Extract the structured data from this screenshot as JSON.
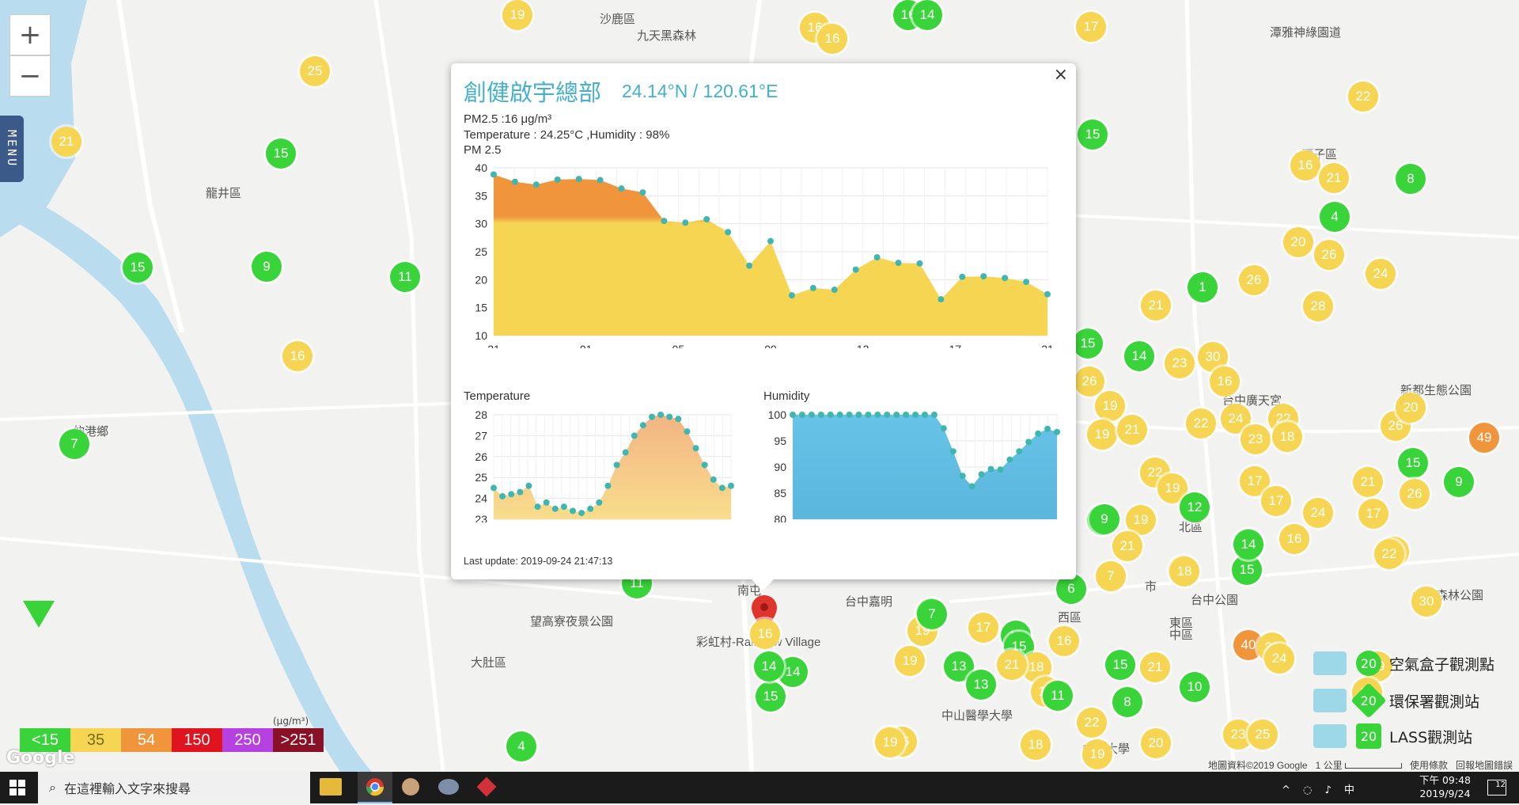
{
  "map": {
    "zoom_in": "+",
    "zoom_out": "−",
    "menu_label": "MENU",
    "places": [
      {
        "name": "沙鹿區"
      },
      {
        "name": "龍井區"
      },
      {
        "name": "伸港鄉"
      },
      {
        "name": "大肚區"
      },
      {
        "name": "潭子區"
      },
      {
        "name": "北區"
      },
      {
        "name": "西區"
      },
      {
        "name": "東區"
      },
      {
        "name": "中區"
      },
      {
        "name": "南屯"
      },
      {
        "name": "望高寮夜景公園"
      },
      {
        "name": "彩虹村-Rainbow Village"
      },
      {
        "name": "九天黑森林"
      },
      {
        "name": "潭雅神綠園道"
      },
      {
        "name": "中山醫學大學"
      },
      {
        "name": "台中嘉明"
      },
      {
        "name": "中興大學"
      },
      {
        "name": "台中公園"
      },
      {
        "name": "市"
      },
      {
        "name": "大坑森林公園"
      },
      {
        "name": "新都生態公園"
      },
      {
        "name": "台中廣天宮"
      }
    ],
    "markers": [
      {
        "v": "19",
        "c": "#f6d553"
      },
      {
        "v": "16",
        "c": "#f6d553"
      },
      {
        "v": "16",
        "c": "#f6d553"
      },
      {
        "v": "16",
        "c": "#39d33a"
      },
      {
        "v": "14",
        "c": "#39d33a"
      },
      {
        "v": "17",
        "c": "#f6d553"
      },
      {
        "v": "25",
        "c": "#f6d553"
      },
      {
        "v": "21",
        "c": "#f6d553"
      },
      {
        "v": "15",
        "c": "#39d33a"
      },
      {
        "v": "15",
        "c": "#39d33a"
      },
      {
        "v": "9",
        "c": "#39d33a"
      },
      {
        "v": "11",
        "c": "#39d33a"
      },
      {
        "v": "16",
        "c": "#f6d553"
      },
      {
        "v": "7",
        "c": "#39d33a"
      },
      {
        "v": "15",
        "c": "#39d33a"
      },
      {
        "v": "22",
        "c": "#f6d553"
      },
      {
        "v": "16",
        "c": "#f6d553"
      },
      {
        "v": "21",
        "c": "#f6d553"
      },
      {
        "v": "8",
        "c": "#39d33a"
      },
      {
        "v": "4",
        "c": "#39d33a"
      },
      {
        "v": "20",
        "c": "#f6d553"
      },
      {
        "v": "26",
        "c": "#f6d553"
      },
      {
        "v": "24",
        "c": "#f6d553"
      },
      {
        "v": "1",
        "c": "#39d33a"
      },
      {
        "v": "26",
        "c": "#f6d553"
      },
      {
        "v": "21",
        "c": "#f6d553"
      },
      {
        "v": "28",
        "c": "#f6d553"
      },
      {
        "v": "15",
        "c": "#39d33a"
      },
      {
        "v": "14",
        "c": "#39d33a"
      },
      {
        "v": "23",
        "c": "#f6d553"
      },
      {
        "v": "30",
        "c": "#f6d553"
      },
      {
        "v": "16",
        "c": "#f6d553"
      },
      {
        "v": "26",
        "c": "#f6d553"
      },
      {
        "v": "19",
        "c": "#f6d553"
      },
      {
        "v": "22",
        "c": "#f6d553"
      },
      {
        "v": "24",
        "c": "#f6d553"
      },
      {
        "v": "22",
        "c": "#f6d553"
      },
      {
        "v": "23",
        "c": "#f6d553"
      },
      {
        "v": "18",
        "c": "#f6d553"
      },
      {
        "v": "19",
        "c": "#f6d553"
      },
      {
        "v": "21",
        "c": "#f6d553"
      },
      {
        "v": "26",
        "c": "#f6d553"
      },
      {
        "v": "20",
        "c": "#f6d553"
      },
      {
        "v": "49",
        "c": "#f0953b"
      },
      {
        "v": "15",
        "c": "#39d33a"
      },
      {
        "v": "22",
        "c": "#f6d553"
      },
      {
        "v": "19",
        "c": "#f6d553"
      },
      {
        "v": "17",
        "c": "#f6d553"
      },
      {
        "v": "21",
        "c": "#f6d553"
      },
      {
        "v": "26",
        "c": "#f6d553"
      },
      {
        "v": "9",
        "c": "#39d33a"
      },
      {
        "v": "12",
        "c": "#39d33a"
      },
      {
        "v": "17",
        "c": "#f6d553"
      },
      {
        "v": "24",
        "c": "#f6d553"
      },
      {
        "v": "17",
        "c": "#f6d553"
      },
      {
        "v": "9",
        "c": "#39d33a"
      },
      {
        "v": "19",
        "c": "#f6d553"
      },
      {
        "v": "21",
        "c": "#f6d553"
      },
      {
        "v": "14",
        "c": "#39d33a"
      },
      {
        "v": "16",
        "c": "#f6d553"
      },
      {
        "v": "22",
        "c": "#f6d553"
      },
      {
        "v": "9",
        "c": "#39d33a"
      },
      {
        "v": "18",
        "c": "#f6d553"
      },
      {
        "v": "15",
        "c": "#39d33a"
      },
      {
        "v": "7",
        "c": "#f6d553"
      },
      {
        "v": "14",
        "c": "#39d33a"
      },
      {
        "v": "18",
        "c": "#f6d553"
      },
      {
        "v": "22",
        "c": "#f6d553"
      },
      {
        "v": "30",
        "c": "#f6d553"
      },
      {
        "v": "6",
        "c": "#39d33a"
      },
      {
        "v": "7",
        "c": "#39d33a"
      },
      {
        "v": "17",
        "c": "#f6d553"
      },
      {
        "v": "11",
        "c": "#39d33a"
      },
      {
        "v": "19",
        "c": "#f6d553"
      },
      {
        "v": "15",
        "c": "#39d33a"
      },
      {
        "v": "40",
        "c": "#f0953b"
      },
      {
        "v": "23",
        "c": "#f6d553"
      },
      {
        "v": "24",
        "c": "#f6d553"
      },
      {
        "v": "19",
        "c": "#f6d553"
      },
      {
        "v": "18",
        "c": "#f6d553"
      },
      {
        "v": "16",
        "c": "#f6d553"
      },
      {
        "v": "18",
        "c": "#f6d553"
      },
      {
        "v": "13",
        "c": "#39d33a"
      },
      {
        "v": "13",
        "c": "#39d33a"
      },
      {
        "v": "21",
        "c": "#f6d553"
      },
      {
        "v": "15",
        "c": "#39d33a"
      },
      {
        "v": "21",
        "c": "#f6d553"
      },
      {
        "v": "10",
        "c": "#39d33a"
      },
      {
        "v": "16",
        "c": "#f6d553"
      },
      {
        "v": "8",
        "c": "#39d33a"
      },
      {
        "v": "11",
        "c": "#39d33a"
      },
      {
        "v": "22",
        "c": "#f6d553"
      },
      {
        "v": "19",
        "c": "#f6d553"
      },
      {
        "v": "16",
        "c": "#f6d553"
      },
      {
        "v": "14",
        "c": "#39d33a"
      },
      {
        "v": "15",
        "c": "#39d33a"
      },
      {
        "v": "4",
        "c": "#39d33a"
      },
      {
        "v": "18",
        "c": "#f6d553"
      },
      {
        "v": "19",
        "c": "#f6d553"
      },
      {
        "v": "20",
        "c": "#f6d553"
      },
      {
        "v": "23",
        "c": "#f6d553"
      },
      {
        "v": "25",
        "c": "#f6d553"
      },
      {
        "v": "11",
        "c": "#39d33a"
      },
      {
        "v": "14",
        "c": "#39d33a"
      },
      {
        "v": "7",
        "c": "#39d33a"
      },
      {
        "v": "16",
        "c": "#f6d553"
      },
      {
        "v": "19",
        "c": "#f6d553"
      }
    ],
    "pin_value": "16"
  },
  "aqi_legend": {
    "unit": "(μg/m³)",
    "items": [
      {
        "label": "<15",
        "color": "#39d33a"
      },
      {
        "label": "35",
        "color": "#f6d553"
      },
      {
        "label": "54",
        "color": "#f0953b"
      },
      {
        "label": "150",
        "color": "#e0141e"
      },
      {
        "label": "250",
        "color": "#b541e0"
      },
      {
        "label": ">251",
        "color": "#8a1025"
      }
    ]
  },
  "station_legend": [
    {
      "label": "空氣盒子觀測點",
      "value": "20"
    },
    {
      "label": "環保署觀測站",
      "value": "20"
    },
    {
      "label": "LASS觀測站",
      "value": "20"
    }
  ],
  "popup": {
    "title": "創健啟宇總部",
    "coord": "24.14°N / 120.61°E",
    "pm_line": "PM2.5 :16 μg/m³",
    "temp_line": "Temperature : 24.25°C ,Humidity : 98%",
    "pm_chart_label": "PM 2.5",
    "last_update": "Last update: 2019-09-24 21:47:13",
    "close": "×"
  },
  "chart_data": [
    {
      "type": "area",
      "title": "PM 2.5",
      "x_ticks": [
        "21",
        "01",
        "05",
        "09",
        "13",
        "17",
        "21"
      ],
      "y_ticks": [
        10,
        15,
        20,
        25,
        30,
        35,
        40
      ],
      "ylim": [
        10,
        40
      ],
      "values": [
        38.8,
        37.5,
        37,
        37.9,
        38,
        37.8,
        36.3,
        35.6,
        30.5,
        30.2,
        30.8,
        28.5,
        22.5,
        26.9,
        17.2,
        18.5,
        18.2,
        21.8,
        24,
        23,
        22.9,
        16.5,
        20.5,
        20.6,
        20.3,
        19.6,
        17.4
      ],
      "threshold": 31,
      "colors": {
        "low": "#f6d553",
        "high": "#f0953b",
        "point": "#3fb6b0"
      }
    },
    {
      "type": "area",
      "title": "Temperature",
      "y_ticks": [
        23,
        24,
        25,
        26,
        27,
        28
      ],
      "ylim": [
        23,
        28
      ],
      "values": [
        24.5,
        24.1,
        24.2,
        24.3,
        24.6,
        23.6,
        23.8,
        23.5,
        23.6,
        23.4,
        23.3,
        23.5,
        23.8,
        24.6,
        25.6,
        26.2,
        27.0,
        27.5,
        27.9,
        28.0,
        27.9,
        27.8,
        27.2,
        26.4,
        25.6,
        24.9,
        24.5,
        24.6
      ],
      "colors": {
        "fill": "#f2b483",
        "point": "#3fb6b0"
      }
    },
    {
      "type": "area",
      "title": "Humidity",
      "y_ticks": [
        80,
        85,
        90,
        95,
        100
      ],
      "ylim": [
        80,
        100
      ],
      "values": [
        100,
        100,
        100,
        100,
        100,
        100,
        100,
        100,
        100,
        100,
        100,
        100,
        100,
        100,
        100,
        100,
        97.4,
        93,
        88.3,
        86.3,
        88.6,
        89.6,
        89.5,
        91.4,
        93,
        94.8,
        96.4,
        97.3,
        96.7
      ],
      "colors": {
        "fill": "#67c3e6",
        "point": "#3fb6b0"
      }
    }
  ],
  "attribution": {
    "google": "Google",
    "mapdata": "地圖資料©2019 Google",
    "scale": "1 公里",
    "terms": "使用條款",
    "report": "回報地圖錯誤"
  },
  "taskbar": {
    "search_placeholder": "在這裡輸入文字來搜尋",
    "time": "下午 09:48",
    "date": "2019/9/24",
    "ime": "中",
    "notif": "12"
  }
}
